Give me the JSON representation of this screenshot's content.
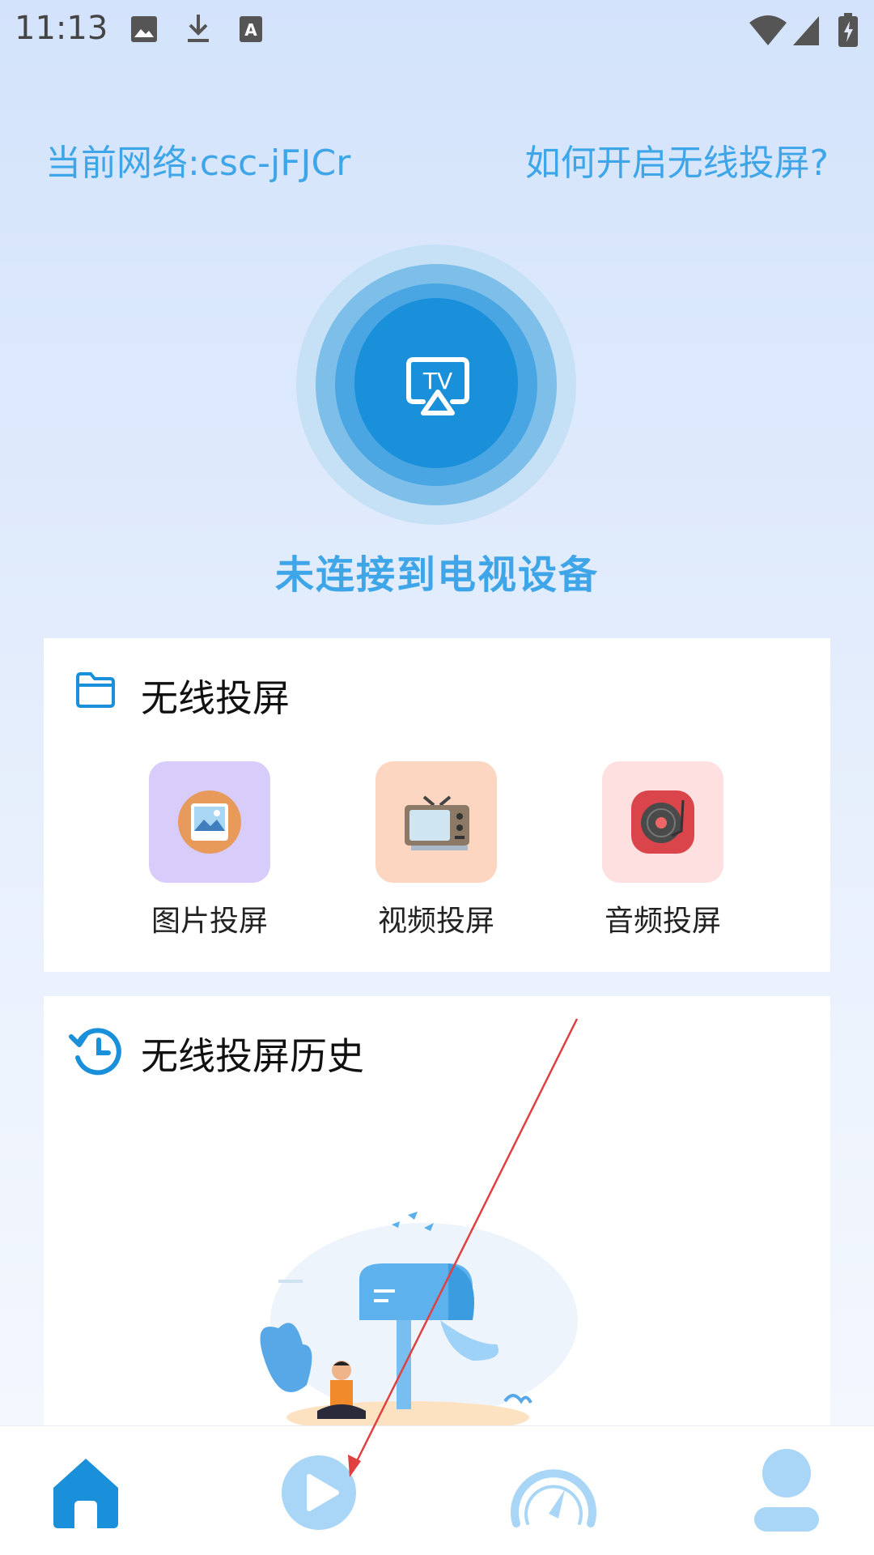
{
  "status_bar": {
    "time": "11:13",
    "icons": [
      "image-icon",
      "download-icon",
      "font-icon",
      "wifi-icon",
      "signal-icon",
      "battery-charging-icon"
    ]
  },
  "network": {
    "label": "当前网络:csc-jFJCr",
    "help_link": "如何开启无线投屏?"
  },
  "cast": {
    "icon_text": "TV",
    "status": "未连接到电视设备"
  },
  "wireless_cast": {
    "title": "无线投屏",
    "items": [
      {
        "label": "图片投屏",
        "icon": "image-cast-icon",
        "bg": "#d8ccfb"
      },
      {
        "label": "视频投屏",
        "icon": "tv-set-icon",
        "bg": "#fdd6c2"
      },
      {
        "label": "音频投屏",
        "icon": "record-player-icon",
        "bg": "#fde0df"
      }
    ]
  },
  "history": {
    "title": "无线投屏历史"
  },
  "bottom_nav": [
    "home-icon",
    "play-icon",
    "speedometer-icon",
    "profile-icon"
  ],
  "colors": {
    "accent": "#3ea6e8",
    "primary_blue": "#1a90da",
    "annotation_arrow": "#e04040"
  }
}
